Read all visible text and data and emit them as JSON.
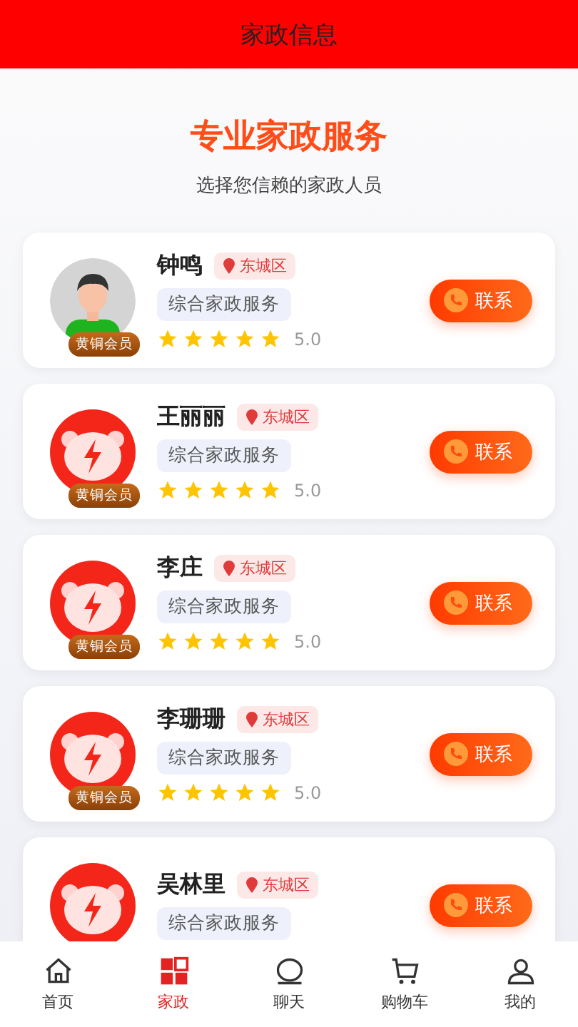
{
  "header": {
    "title": "家政信息"
  },
  "hero": {
    "title": "专业家政服务",
    "subtitle": "选择您信赖的家政人员"
  },
  "workers": [
    {
      "name": "钟鸣",
      "location": "东城区",
      "service": "综合家政服务",
      "badge": "黄铜会员",
      "stars": 5,
      "rating": "5.0",
      "action": "联系"
    },
    {
      "name": "王丽丽",
      "location": "东城区",
      "service": "综合家政服务",
      "badge": "黄铜会员",
      "stars": 5,
      "rating": "5.0",
      "action": "联系"
    },
    {
      "name": "李庄",
      "location": "东城区",
      "service": "综合家政服务",
      "badge": "黄铜会员",
      "stars": 5,
      "rating": "5.0",
      "action": "联系"
    },
    {
      "name": "李珊珊",
      "location": "东城区",
      "service": "综合家政服务",
      "badge": "黄铜会员",
      "stars": 5,
      "rating": "5.0",
      "action": "联系"
    },
    {
      "name": "吴林里",
      "location": "东城区",
      "service": "综合家政服务",
      "action": "联系"
    }
  ],
  "tabbar": [
    {
      "label": "首页",
      "selected": false
    },
    {
      "label": "家政",
      "selected": true
    },
    {
      "label": "聊天",
      "selected": false
    },
    {
      "label": "购物车",
      "selected": false
    },
    {
      "label": "我的",
      "selected": false
    }
  ]
}
